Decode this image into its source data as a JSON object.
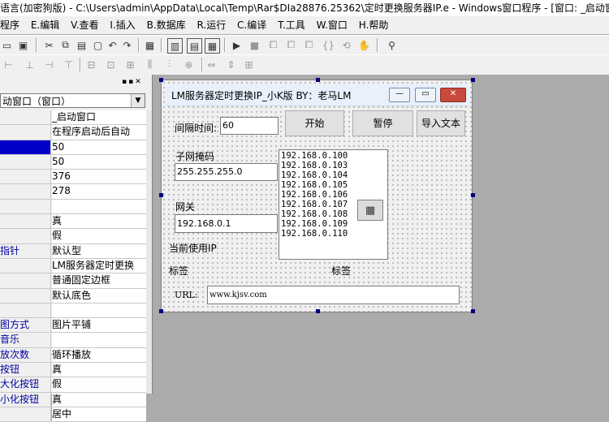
{
  "window": {
    "title": "语言(加密狗版) - C:\\Users\\admin\\AppData\\Local\\Temp\\Rar$DIa28876.25362\\定时更换服务器IP.e - Windows窗口程序 - [窗口: _启动窗"
  },
  "menu": [
    "程序",
    "E.编辑",
    "V.查看",
    "I.插入",
    "B.数据库",
    "R.运行",
    "C.编译",
    "T.工具",
    "W.窗口",
    "H.帮助"
  ],
  "left_panel": {
    "combo_value": "动窗口（窗口）",
    "properties": [
      {
        "name": "",
        "value": "_启动窗口"
      },
      {
        "name": "",
        "value": "在程序启动后自动"
      },
      {
        "name": "",
        "value": "50",
        "selected": true
      },
      {
        "name": "",
        "value": "50"
      },
      {
        "name": "",
        "value": "376"
      },
      {
        "name": "",
        "value": "278"
      },
      {
        "name": "",
        "value": ""
      },
      {
        "name": "",
        "value": "真"
      },
      {
        "name": "",
        "value": "假"
      },
      {
        "name": "指针",
        "value": "默认型"
      },
      {
        "name": "",
        "value": "LM服务器定时更换"
      },
      {
        "name": "",
        "value": "普通固定边框"
      },
      {
        "name": "",
        "value": "默认底色"
      },
      {
        "name": "",
        "value": ""
      },
      {
        "name": "图方式",
        "value": "图片平铺"
      },
      {
        "name": "音乐",
        "value": ""
      },
      {
        "name": "放次数",
        "value": "循环播放"
      },
      {
        "name": "按钮",
        "value": "真"
      },
      {
        "name": "大化按钮",
        "value": "假"
      },
      {
        "name": "小化按钮",
        "value": "真"
      },
      {
        "name": "",
        "value": "居中"
      }
    ]
  },
  "form": {
    "caption": "LM服务器定时更换IP_小K版 BY：老马LM",
    "interval_label": "间隔时间:",
    "interval_value": "60",
    "start_button": "开始",
    "pause_button": "暂停",
    "import_button": "导入文本",
    "subnet_label": "子网掩码",
    "subnet_value": "255.255.255.0",
    "gateway_label": "网关",
    "gateway_value": "192.168.0.1",
    "current_ip_label": "当前使用IP",
    "ip_list": [
      "192.168.0.100",
      "192.168.0.103",
      "192.168.0.104",
      "192.168.0.105",
      "192.168.0.106",
      "192.168.0.107",
      "192.168.0.108",
      "192.168.0.109",
      "192.168.0.110"
    ],
    "label1": "标签",
    "label2": "标签",
    "url_label": "URL:",
    "url_value": "www.kjsv.com"
  }
}
